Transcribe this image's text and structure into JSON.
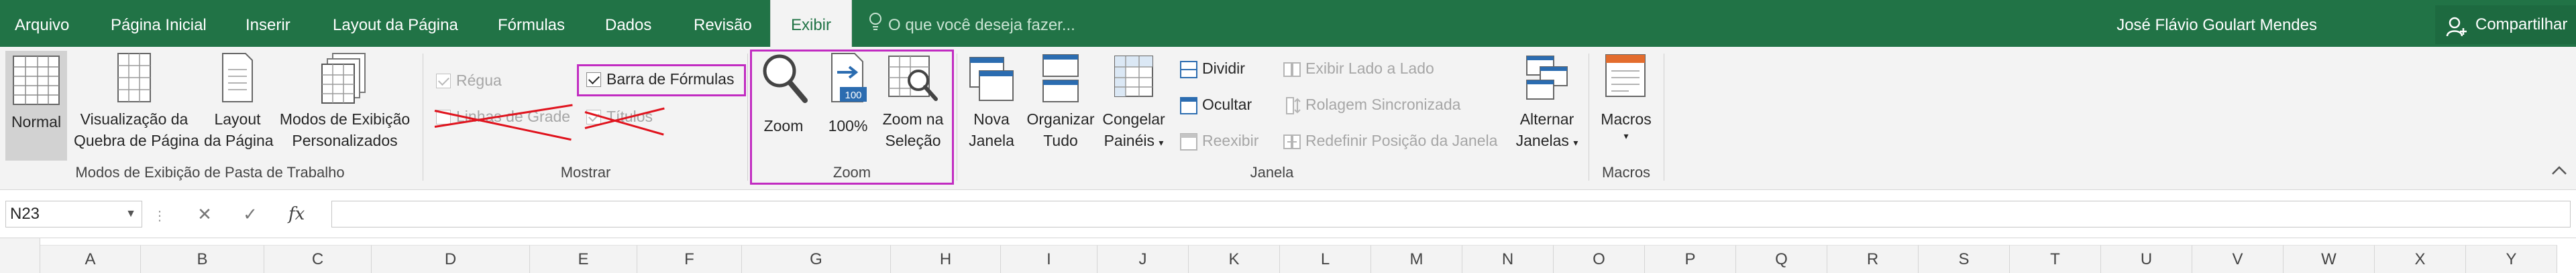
{
  "menu": {
    "tabs": [
      "Arquivo",
      "Página Inicial",
      "Inserir",
      "Layout da Página",
      "Fórmulas",
      "Dados",
      "Revisão",
      "Exibir"
    ],
    "active_tab": "Exibir",
    "tell_me_placeholder": "O que você deseja fazer...",
    "user_name": "José Flávio Goulart Mendes",
    "share_label": "Compartilhar"
  },
  "ribbon": {
    "workbook_views": {
      "group_label": "Modos de Exibição de Pasta de Trabalho",
      "normal": "Normal",
      "page_break_line1": "Visualização da",
      "page_break_line2": "Quebra de Página",
      "page_layout_line1": "Layout",
      "page_layout_line2": "da Página",
      "custom_views_line1": "Modos de Exibição",
      "custom_views_line2": "Personalizados"
    },
    "show": {
      "group_label": "Mostrar",
      "ruler": "Régua",
      "ruler_checked": true,
      "gridlines": "Linhas de Grade",
      "gridlines_checked": false,
      "formula_bar": "Barra de Fórmulas",
      "formula_bar_checked": true,
      "headings": "Títulos",
      "headings_checked": true
    },
    "zoom": {
      "group_label": "Zoom",
      "zoom": "Zoom",
      "hundred": "100%",
      "zoom_selection_line1": "Zoom na",
      "zoom_selection_line2": "Seleção"
    },
    "window": {
      "group_label": "Janela",
      "new_window_line1": "Nova",
      "new_window_line2": "Janela",
      "arrange_line1": "Organizar",
      "arrange_line2": "Tudo",
      "freeze_line1": "Congelar",
      "freeze_line2": "Painéis",
      "split": "Dividir",
      "hide": "Ocultar",
      "unhide": "Reexibir",
      "side_by_side": "Exibir Lado a Lado",
      "sync_scroll": "Rolagem Sincronizada",
      "reset_position": "Redefinir Posição da Janela",
      "switch_line1": "Alternar",
      "switch_line2": "Janelas"
    },
    "macros": {
      "group_label": "Macros",
      "macros": "Macros"
    }
  },
  "formula_bar": {
    "name_box": "N23",
    "cancel_icon": "✕",
    "enter_icon": "✓",
    "fx_label": "fx",
    "formula_value": ""
  },
  "columns": [
    "A",
    "B",
    "C",
    "D",
    "E",
    "F",
    "G",
    "H",
    "I",
    "J",
    "K",
    "L",
    "M",
    "N",
    "O",
    "P",
    "Q",
    "R",
    "S",
    "T",
    "U",
    "V",
    "W",
    "X",
    "Y"
  ],
  "colors": {
    "excel_green": "#217346",
    "highlight_magenta": "#c12bc1",
    "strike_red": "#e0141e"
  }
}
